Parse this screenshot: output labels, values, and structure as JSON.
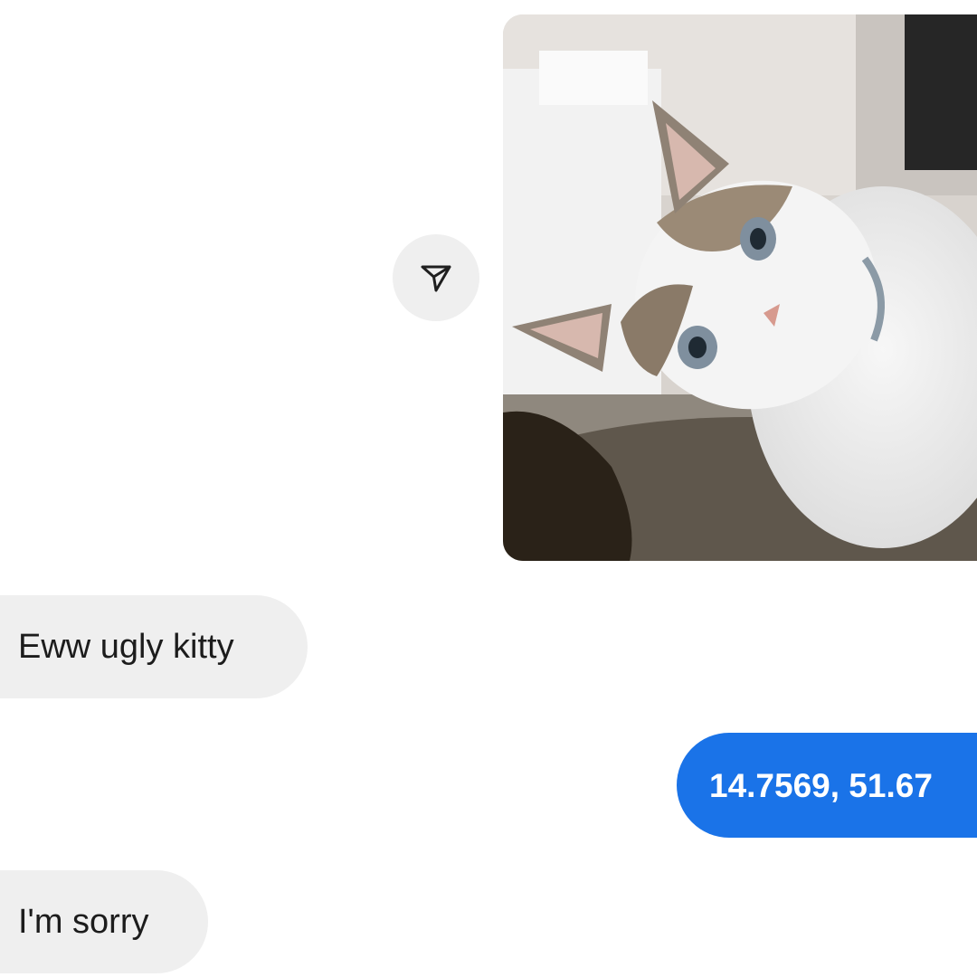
{
  "conversation": {
    "messages": [
      {
        "sender": "them",
        "type": "photo",
        "content_icon": "cat-photo",
        "action_icon": "send-forward-icon"
      },
      {
        "sender": "them",
        "type": "text",
        "text": "Eww ugly kitty"
      },
      {
        "sender": "me",
        "type": "text",
        "text": "14.7569, 51.67"
      },
      {
        "sender": "them",
        "type": "text",
        "text": "I'm sorry"
      }
    ]
  },
  "colors": {
    "incoming_bubble": "#efefef",
    "outgoing_bubble": "#1a73e8",
    "background": "#ffffff",
    "text_dark": "#1c1c1c",
    "text_light": "#ffffff"
  }
}
